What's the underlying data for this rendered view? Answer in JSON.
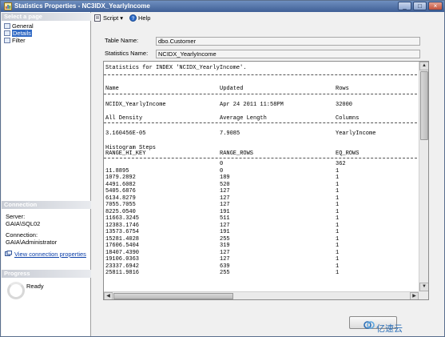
{
  "window": {
    "title": "Statistics Properties - NC3IDX_YearlyIncome",
    "min_glyph": "_",
    "max_glyph": "□",
    "close_glyph": "×"
  },
  "left_pane": {
    "select_page_header": "Select a page",
    "pages": [
      {
        "label": "General"
      },
      {
        "label": "Details"
      },
      {
        "label": "Filter"
      }
    ],
    "connection_header": "Connection",
    "server_label": "Server:",
    "server_value": "GAIA\\SQL02",
    "connection_label": "Connection:",
    "connection_value": "GAIA\\Administrator",
    "view_connection_link": "View connection properties",
    "progress_header": "Progress",
    "progress_status": "Ready"
  },
  "toolbar": {
    "script_label": "Script",
    "help_label": "Help",
    "dropdown_glyph": "▾"
  },
  "form": {
    "table_name_label": "Table Name:",
    "table_name_value": "dbo.Customer",
    "statistics_name_label": "Statistics Name:",
    "statistics_name_value": "NCIDX_YearlyIncome"
  },
  "results": {
    "heading": "Statistics for INDEX 'NCIDX_YearlyIncome'.",
    "header_row": [
      "Name",
      "Updated",
      "Rows"
    ],
    "info_row": [
      "NCIDX_YearlyIncome",
      "Apr 24 2011 11:58PM",
      "32000"
    ],
    "density_header": [
      "All Density",
      "Average Length",
      "Columns"
    ],
    "density_row": [
      "3.160456E-05",
      "7.9085",
      "YearlyIncome"
    ],
    "histogram_title": "Histogram Steps",
    "histogram_header": [
      "RANGE_HI_KEY",
      "RANGE_ROWS",
      "EQ_ROWS"
    ],
    "histogram_rows": [
      [
        "",
        "0",
        "362"
      ],
      [
        "11.8895",
        "0",
        "1"
      ],
      [
        "1079.2892",
        "189",
        "1"
      ],
      [
        "4491.6082",
        "520",
        "1"
      ],
      [
        "5405.6876",
        "127",
        "1"
      ],
      [
        "6134.8279",
        "127",
        "1"
      ],
      [
        "7055.7055",
        "127",
        "1"
      ],
      [
        "8225.0540",
        "191",
        "1"
      ],
      [
        "11663.3245",
        "511",
        "1"
      ],
      [
        "12383.1746",
        "127",
        "1"
      ],
      [
        "13573.6754",
        "191",
        "1"
      ],
      [
        "15281.4028",
        "255",
        "1"
      ],
      [
        "17606.5404",
        "319",
        "1"
      ],
      [
        "18407.4390",
        "127",
        "1"
      ],
      [
        "19106.0363",
        "127",
        "1"
      ],
      [
        "23337.6942",
        "639",
        "1"
      ],
      [
        "25811.9816",
        "255",
        "1"
      ]
    ]
  },
  "scroll": {
    "up_glyph": "▲",
    "down_glyph": "▼",
    "left_glyph": "◀",
    "right_glyph": "▶"
  },
  "watermark": {
    "text": "亿速云"
  },
  "colors": {
    "titlebar": "#3f5f96",
    "selection": "#316ac5",
    "link": "#0b3fa8",
    "watermark": "#2c6fb7"
  },
  "icons": [
    "window-icon",
    "page-icon",
    "script-icon",
    "help-icon",
    "connection-link-icon",
    "progress-icon",
    "watermark-logo-icon"
  ]
}
